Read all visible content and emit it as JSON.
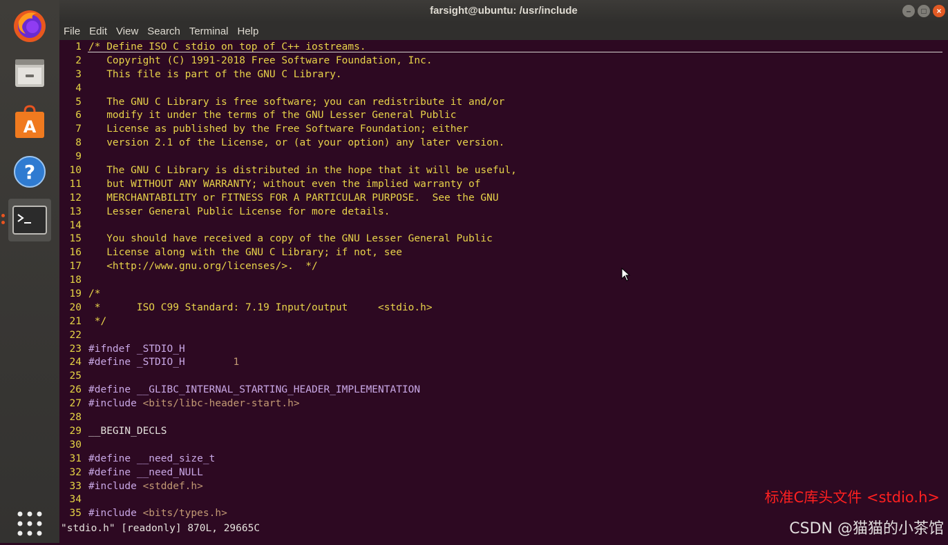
{
  "window": {
    "title": "farsight@ubuntu: /usr/include"
  },
  "menu": [
    "File",
    "Edit",
    "View",
    "Search",
    "Terminal",
    "Help"
  ],
  "dock": [
    {
      "name": "firefox-icon"
    },
    {
      "name": "files-icon"
    },
    {
      "name": "software-center-icon"
    },
    {
      "name": "help-icon"
    },
    {
      "name": "terminal-icon",
      "active": true
    }
  ],
  "editor": {
    "lines": [
      {
        "n": "1",
        "parts": [
          [
            "c",
            "/* Define ISO C stdio on top of C++ iostreams."
          ]
        ]
      },
      {
        "n": "2",
        "parts": [
          [
            "c",
            "   Copyright (C) 1991-2018 Free Software Foundation, Inc."
          ]
        ]
      },
      {
        "n": "3",
        "parts": [
          [
            "c",
            "   This file is part of the GNU C Library."
          ]
        ]
      },
      {
        "n": "4",
        "parts": []
      },
      {
        "n": "5",
        "parts": [
          [
            "c",
            "   The GNU C Library is free software; you can redistribute it and/or"
          ]
        ]
      },
      {
        "n": "6",
        "parts": [
          [
            "c",
            "   modify it under the terms of the GNU Lesser General Public"
          ]
        ]
      },
      {
        "n": "7",
        "parts": [
          [
            "c",
            "   License as published by the Free Software Foundation; either"
          ]
        ]
      },
      {
        "n": "8",
        "parts": [
          [
            "c",
            "   version 2.1 of the License, or (at your option) any later version."
          ]
        ]
      },
      {
        "n": "9",
        "parts": []
      },
      {
        "n": "10",
        "parts": [
          [
            "c",
            "   The GNU C Library is distributed in the hope that it will be useful,"
          ]
        ]
      },
      {
        "n": "11",
        "parts": [
          [
            "c",
            "   but WITHOUT ANY WARRANTY; without even the implied warranty of"
          ]
        ]
      },
      {
        "n": "12",
        "parts": [
          [
            "c",
            "   MERCHANTABILITY or FITNESS FOR A PARTICULAR PURPOSE.  See the GNU"
          ]
        ]
      },
      {
        "n": "13",
        "parts": [
          [
            "c",
            "   Lesser General Public License for more details."
          ]
        ]
      },
      {
        "n": "14",
        "parts": []
      },
      {
        "n": "15",
        "parts": [
          [
            "c",
            "   You should have received a copy of the GNU Lesser General Public"
          ]
        ]
      },
      {
        "n": "16",
        "parts": [
          [
            "c",
            "   License along with the GNU C Library; if not, see"
          ]
        ]
      },
      {
        "n": "17",
        "parts": [
          [
            "c",
            "   <http://www.gnu.org/licenses/>.  */"
          ]
        ]
      },
      {
        "n": "18",
        "parts": []
      },
      {
        "n": "19",
        "parts": [
          [
            "c",
            "/*"
          ]
        ]
      },
      {
        "n": "20",
        "parts": [
          [
            "c",
            " *      ISO C99 Standard: 7.19 Input/output     <stdio.h>"
          ]
        ]
      },
      {
        "n": "21",
        "parts": [
          [
            "c",
            " */"
          ]
        ]
      },
      {
        "n": "22",
        "parts": []
      },
      {
        "n": "23",
        "parts": [
          [
            "pp",
            "#ifndef _STDIO_H"
          ]
        ]
      },
      {
        "n": "24",
        "parts": [
          [
            "pp",
            "#define _STDIO_H        "
          ],
          [
            "str",
            "1"
          ]
        ]
      },
      {
        "n": "25",
        "parts": []
      },
      {
        "n": "26",
        "parts": [
          [
            "pp",
            "#define __GLIBC_INTERNAL_STARTING_HEADER_IMPLEMENTATION"
          ]
        ]
      },
      {
        "n": "27",
        "parts": [
          [
            "pp",
            "#include "
          ],
          [
            "str",
            "<bits/libc-header-start.h>"
          ]
        ]
      },
      {
        "n": "28",
        "parts": []
      },
      {
        "n": "29",
        "parts": [
          [
            "w",
            "__BEGIN_DECLS"
          ]
        ]
      },
      {
        "n": "30",
        "parts": []
      },
      {
        "n": "31",
        "parts": [
          [
            "pp",
            "#define __need_size_t"
          ]
        ]
      },
      {
        "n": "32",
        "parts": [
          [
            "pp",
            "#define __need_NULL"
          ]
        ]
      },
      {
        "n": "33",
        "parts": [
          [
            "pp",
            "#include "
          ],
          [
            "str",
            "<stddef.h>"
          ]
        ]
      },
      {
        "n": "34",
        "parts": []
      },
      {
        "n": "35",
        "parts": [
          [
            "pp",
            "#include "
          ],
          [
            "str",
            "<bits/types.h>"
          ]
        ]
      }
    ],
    "status": "\"stdio.h\" [readonly] 870L, 29665C"
  },
  "overlay": {
    "caption": "标准C库头文件 <stdio.h>",
    "watermark": "CSDN @猫猫的小茶馆"
  },
  "colors": {
    "background": "#2d0922",
    "comment": "#e8d34a",
    "preproc": "#c9a8e6",
    "string": "#c39a74",
    "caption": "#ff2020"
  }
}
